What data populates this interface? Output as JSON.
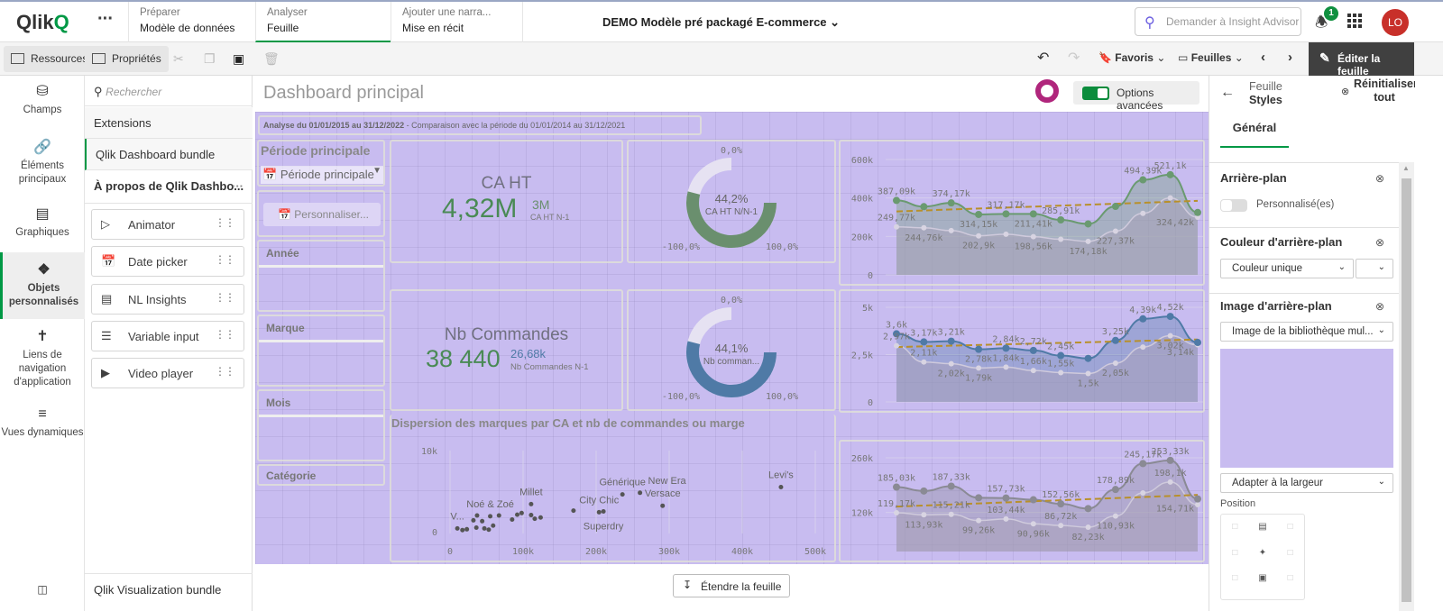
{
  "topbar": {
    "logo": "Qlik",
    "menu": "···",
    "tabs": [
      {
        "sub": "Préparer",
        "main": "Modèle de données"
      },
      {
        "sub": "Analyser",
        "main": "Feuille"
      },
      {
        "sub": "Ajouter une narra...",
        "main": "Mise en récit"
      }
    ],
    "app_title": "DEMO Modèle pré packagé E-commerce",
    "search_placeholder": "Demander à Insight Advisor",
    "notifications": "1",
    "avatar": "LO"
  },
  "toolbar": {
    "resources": "Ressources",
    "properties": "Propriétés",
    "favorites": "Favoris",
    "sheets": "Feuilles",
    "edit": "Éditer la feuille"
  },
  "rail": [
    {
      "label": "Champs",
      "icon": "database-icon"
    },
    {
      "label": "Éléments principaux",
      "icon": "link-icon"
    },
    {
      "label": "Graphiques",
      "icon": "chart-icon"
    },
    {
      "label": "Objets personnalisés",
      "icon": "puzzle-icon"
    },
    {
      "label": "Liens de navigation d'application",
      "icon": "signpost-icon"
    },
    {
      "label": "Vues dynamiques",
      "icon": "dynamic-view-icon"
    }
  ],
  "panel": {
    "search_placeholder": "Rechercher",
    "extensions": "Extensions",
    "bundle": "Qlik Dashboard bundle",
    "about": "À propos de Qlik Dashbo...",
    "items": [
      "Animator",
      "Date picker",
      "NL Insights",
      "Variable input",
      "Video player"
    ],
    "bottom": "Qlik Visualization bundle"
  },
  "sheet": {
    "title": "Dashboard principal",
    "advanced_options": "Options avancées",
    "analysis_bold": "Analyse du 01/01/2015 au 31/12/2022",
    "analysis_rest": " - Comparaison avec la période du 01/01/2014 au 31/12/2021",
    "period_title": "Période principale",
    "period_select": "Période principale",
    "customize": "Personnaliser...",
    "filters": [
      "Année",
      "Marque",
      "Mois",
      "Catégorie"
    ],
    "kpi1": {
      "title": "CA HT",
      "value": "4,32M",
      "compare": "3M",
      "compare_label": "CA HT N-1"
    },
    "kpi2": {
      "title": "Nb Commandes",
      "value": "38 440",
      "compare": "26,68k",
      "compare_label": "Nb Commandes N-1"
    },
    "gauge1": {
      "value": 44.2,
      "label": "44,2%",
      "sub": "CA HT N/N-1",
      "min": "-100,0%",
      "mid": "0,0%",
      "max": "100,0%",
      "color": "#6a8f6e"
    },
    "gauge2": {
      "value": 44.1,
      "label": "44,1%",
      "sub": "Nb comman...",
      "min": "-100,0%",
      "mid": "0,0%",
      "max": "100,0%",
      "color": "#4f7aa6"
    },
    "scatter_title": "Dispersion des marques par CA et nb de commandes ou marge",
    "expand": "Étendre la feuille"
  },
  "chart_data": [
    {
      "type": "line",
      "id": "ca",
      "ylim": [
        0,
        600
      ],
      "ticks": [
        "0",
        "200k",
        "400k",
        "600k"
      ],
      "tickvals": [
        0,
        200,
        400,
        600
      ],
      "color": "#6a9a70",
      "series": [
        {
          "values": [
            387.09,
            355,
            374.17,
            314.15,
            317.17,
            317,
            285.91,
            265,
            356,
            494.39,
            521.1,
            324.42
          ]
        },
        {
          "values": [
            249.77,
            244.76,
            230,
            202.9,
            211.41,
            198.56,
            185,
            174.18,
            227.37,
            320,
            400,
            300
          ]
        }
      ],
      "labels": [
        {
          "i": 0,
          "t": "387,09k",
          "s": 0
        },
        {
          "i": 2,
          "t": "374,17k",
          "s": 0
        },
        {
          "i": 3,
          "t": "314,15k",
          "s": 1
        },
        {
          "i": 4,
          "t": "317,17k",
          "s": 0
        },
        {
          "i": 5,
          "t": "211,41k",
          "s": 1
        },
        {
          "i": 6,
          "t": "285,91k",
          "s": 0
        },
        {
          "i": 9,
          "t": "494,39k",
          "s": 0
        },
        {
          "i": 10,
          "t": "521,1k",
          "s": 0
        },
        {
          "i": 11,
          "t": "324,42k",
          "s": 1
        },
        {
          "i": 0,
          "t": "249,77k",
          "s": 2
        },
        {
          "i": 1,
          "t": "244,76k",
          "s": 3
        },
        {
          "i": 3,
          "t": "202,9k",
          "s": 3
        },
        {
          "i": 5,
          "t": "198,56k",
          "s": 3
        },
        {
          "i": 7,
          "t": "174,18k",
          "s": 3
        },
        {
          "i": 8,
          "t": "227,37k",
          "s": 3
        }
      ],
      "trend": [
        330,
        385
      ]
    },
    {
      "type": "line",
      "id": "orders",
      "ylim": [
        0,
        5
      ],
      "ticks": [
        "0",
        "2,5k",
        "5k"
      ],
      "tickvals": [
        0,
        2.5,
        5
      ],
      "color": "#4f7aa6",
      "series": [
        {
          "values": [
            3.6,
            3.17,
            3.21,
            2.78,
            2.84,
            2.72,
            2.45,
            2.3,
            3.25,
            4.39,
            4.52,
            3.14
          ]
        },
        {
          "values": [
            2.97,
            2.11,
            2.02,
            1.79,
            1.84,
            1.66,
            1.55,
            1.5,
            2.05,
            2.9,
            3.5,
            3.02
          ]
        }
      ],
      "labels": [
        {
          "i": 0,
          "t": "3,6k",
          "s": 0
        },
        {
          "i": 1,
          "t": "3,17k",
          "s": 0
        },
        {
          "i": 2,
          "t": "3,21k",
          "s": 0
        },
        {
          "i": 3,
          "t": "2,78k",
          "s": 1
        },
        {
          "i": 4,
          "t": "2,84k",
          "s": 0
        },
        {
          "i": 5,
          "t": "2,72k",
          "s": 0
        },
        {
          "i": 6,
          "t": "2,45k",
          "s": 0
        },
        {
          "i": 8,
          "t": "3,25k",
          "s": 0
        },
        {
          "i": 9,
          "t": "4,39k",
          "s": 0
        },
        {
          "i": 10,
          "t": "4,52k",
          "s": 0
        },
        {
          "i": 11,
          "t": "3,14k",
          "s": 1
        },
        {
          "i": 0,
          "t": "2,97k",
          "s": 2
        },
        {
          "i": 1,
          "t": "2,11k",
          "s": 2
        },
        {
          "i": 2,
          "t": "2,02k",
          "s": 3
        },
        {
          "i": 3,
          "t": "1,79k",
          "s": 3
        },
        {
          "i": 4,
          "t": "1,84k",
          "s": 2
        },
        {
          "i": 5,
          "t": "1,66k",
          "s": 2
        },
        {
          "i": 6,
          "t": "1,55k",
          "s": 2
        },
        {
          "i": 7,
          "t": "1,5k",
          "s": 3
        },
        {
          "i": 8,
          "t": "2,05k",
          "s": 3
        },
        {
          "i": 10,
          "t": "3,02k",
          "s": 3
        }
      ],
      "trend": [
        2.9,
        3.3
      ]
    },
    {
      "type": "line",
      "id": "third",
      "ylim": [
        20,
        260
      ],
      "ticks": [
        "120k",
        "260k"
      ],
      "tickvals": [
        120,
        260
      ],
      "color": "#8a8a94",
      "series": [
        {
          "values": [
            185.03,
            175,
            187.33,
            157.73,
            157,
            152.56,
            142,
            130,
            178.89,
            245.17,
            253.33,
            154.71
          ]
        },
        {
          "values": [
            119.17,
            113.93,
            115.21,
            99.26,
            103.44,
            90.96,
            86.72,
            82.23,
            110.93,
            170,
            198.1,
            140
          ]
        }
      ],
      "labels": [
        {
          "i": 0,
          "t": "185,03k",
          "s": 0
        },
        {
          "i": 2,
          "t": "187,33k",
          "s": 0
        },
        {
          "i": 4,
          "t": "157,73k",
          "s": 0
        },
        {
          "i": 6,
          "t": "152,56k",
          "s": 0
        },
        {
          "i": 8,
          "t": "178,89k",
          "s": 0
        },
        {
          "i": 9,
          "t": "245,17k",
          "s": 0
        },
        {
          "i": 10,
          "t": "253,33k",
          "s": 0
        },
        {
          "i": 11,
          "t": "154,71k",
          "s": 1
        },
        {
          "i": 0,
          "t": "119,17k",
          "s": 2
        },
        {
          "i": 1,
          "t": "113,93k",
          "s": 3
        },
        {
          "i": 2,
          "t": "115,21k",
          "s": 2
        },
        {
          "i": 3,
          "t": "99,26k",
          "s": 3
        },
        {
          "i": 4,
          "t": "103,44k",
          "s": 2
        },
        {
          "i": 5,
          "t": "90,96k",
          "s": 3
        },
        {
          "i": 6,
          "t": "86,72k",
          "s": 2
        },
        {
          "i": 7,
          "t": "82,23k",
          "s": 3
        },
        {
          "i": 8,
          "t": "110,93k",
          "s": 3
        },
        {
          "i": 10,
          "t": "198,1k",
          "s": 2
        }
      ],
      "trend": [
        135,
        165
      ]
    },
    {
      "type": "scatter",
      "id": "brands",
      "title": "Dispersion des marques par CA et nb de commandes ou marge",
      "xlim": [
        0,
        500
      ],
      "ylim": [
        0,
        10
      ],
      "xticks": [
        "0",
        "100k",
        "200k",
        "300k",
        "400k",
        "500k"
      ],
      "xtickvals": [
        0,
        100,
        200,
        300,
        400,
        500
      ],
      "yticks": [
        "0",
        "10k"
      ],
      "ytickvals": [
        0,
        10
      ],
      "points": [
        {
          "x": 453,
          "y": 5.5,
          "label": "Levi's"
        },
        {
          "x": 236,
          "y": 4.6,
          "label": "Générique"
        },
        {
          "x": 260,
          "y": 4.8,
          "label": "New Era"
        },
        {
          "x": 291,
          "y": 3.2,
          "label": "Versace"
        },
        {
          "x": 204,
          "y": 2.4,
          "label": "City Chic"
        },
        {
          "x": 210,
          "y": 2.5,
          "label": "Superdry"
        },
        {
          "x": 111,
          "y": 3.4,
          "label": "Millet"
        },
        {
          "x": 55,
          "y": 1.9,
          "label": "Noé & Zoé"
        },
        {
          "x": 10,
          "y": 0.4,
          "label": "V..."
        },
        {
          "x": 169,
          "y": 2.6
        },
        {
          "x": 124,
          "y": 1.75
        },
        {
          "x": 116,
          "y": 1.6
        },
        {
          "x": 111,
          "y": 2.05
        },
        {
          "x": 98,
          "y": 2.3
        },
        {
          "x": 92,
          "y": 2.1
        },
        {
          "x": 85,
          "y": 1.5
        },
        {
          "x": 67,
          "y": 2
        },
        {
          "x": 37,
          "y": 2
        },
        {
          "x": 59,
          "y": 0.75
        },
        {
          "x": 44,
          "y": 1.3
        },
        {
          "x": 32,
          "y": 1.4
        },
        {
          "x": 53,
          "y": 0.25
        },
        {
          "x": 47,
          "y": 0.4
        },
        {
          "x": 23,
          "y": 0.3
        },
        {
          "x": 17,
          "y": 0.2
        },
        {
          "x": 36,
          "y": 0.5
        }
      ]
    }
  ],
  "right": {
    "back_top": "Feuille",
    "back_bottom": "Styles",
    "reset": "Réinitialiser tout",
    "tab": "Général",
    "bg_title": "Arrière-plan",
    "custom": "Personnalisé(es)",
    "bg_color_title": "Couleur d'arrière-plan",
    "color_select": "Couleur unique",
    "bg_image_title": "Image d'arrière-plan",
    "image_select": "Image de la bibliothèque mul...",
    "fit_select": "Adapter à la largeur",
    "position": "Position",
    "preview_color": "#c8bcf0"
  },
  "colors": {
    "accent": "#009845",
    "sheet_bg": "#c8bcf0",
    "trend": "#b8902a"
  }
}
